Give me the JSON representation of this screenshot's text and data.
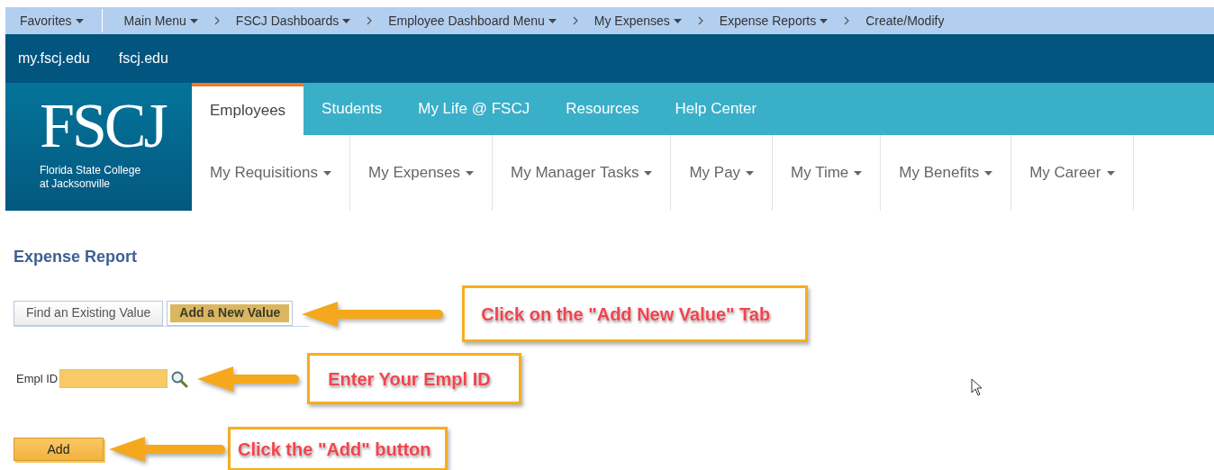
{
  "breadcrumbs": [
    {
      "label": "Favorites",
      "has_menu": true,
      "kind": "plain"
    },
    {
      "label": "Main Menu",
      "has_menu": true,
      "kind": "plain"
    },
    {
      "label": "FSCJ Dashboards",
      "has_menu": true,
      "kind": "chevron"
    },
    {
      "label": "Employee Dashboard Menu",
      "has_menu": true,
      "kind": "chevron"
    },
    {
      "label": "My Expenses",
      "has_menu": true,
      "kind": "chevron"
    },
    {
      "label": "Expense Reports",
      "has_menu": true,
      "kind": "chevron"
    },
    {
      "label": "Create/Modify",
      "has_menu": false,
      "kind": "chevron"
    }
  ],
  "site_links": [
    "my.fscj.edu",
    "fscj.edu"
  ],
  "logo": {
    "wordmark": "FSCJ",
    "tagline_lines": [
      "Florida State College",
      "at Jacksonville"
    ]
  },
  "audience_tabs": [
    {
      "label": "Employees",
      "selected": true
    },
    {
      "label": "Students",
      "selected": false
    },
    {
      "label": "My Life @ FSCJ",
      "selected": false
    },
    {
      "label": "Resources",
      "selected": false
    },
    {
      "label": "Help Center",
      "selected": false
    }
  ],
  "menu_items": [
    {
      "label": "My Requisitions",
      "has_menu": true
    },
    {
      "label": "My Expenses",
      "has_menu": true
    },
    {
      "label": "My Manager Tasks",
      "has_menu": true
    },
    {
      "label": "My Pay",
      "has_menu": true
    },
    {
      "label": "My Time",
      "has_menu": true
    },
    {
      "label": "My Benefits",
      "has_menu": true
    },
    {
      "label": "My Career",
      "has_menu": true
    }
  ],
  "page_title": "Expense Report",
  "page_tabs": [
    {
      "label": "Find an Existing Value",
      "selected": false
    },
    {
      "label": "Add a New Value",
      "selected": true
    }
  ],
  "empl_id": {
    "label": "Empl ID"
  },
  "add_button": "Add",
  "callouts": [
    "Click on the \"Add New Value\" Tab",
    "Enter Your Empl ID",
    "Click the \"Add\" button"
  ]
}
